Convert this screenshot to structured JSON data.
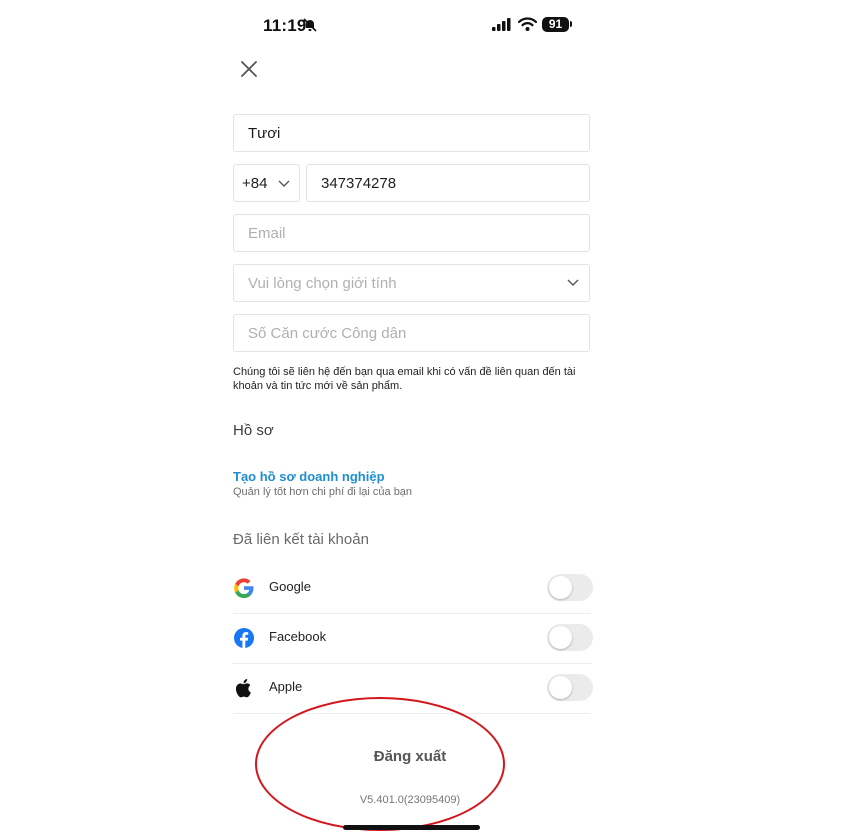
{
  "status_bar": {
    "time": "11:19",
    "battery": "91"
  },
  "form": {
    "name_value": "Tươi",
    "country_code": "+84",
    "phone_value": "347374278",
    "email_placeholder": "Email",
    "gender_placeholder": "Vui lòng chọn giới tính",
    "id_placeholder": "Số Căn cước Công dân",
    "note": "Chúng tôi sẽ liên hệ đến bạn qua email khi có vấn đề liên quan đến tài khoản và tin tức mới về sản phẩm."
  },
  "profile": {
    "heading": "Hồ sơ",
    "business_link": "Tạo hồ sơ doanh nghiệp",
    "business_subtitle": "Quản lý tốt hơn chi phí đi lại của bạn"
  },
  "linked": {
    "heading": "Đã liên kết tài khoản",
    "accounts": [
      {
        "label": "Google",
        "icon": "google-icon",
        "enabled": false
      },
      {
        "label": "Facebook",
        "icon": "facebook-icon",
        "enabled": false
      },
      {
        "label": "Apple",
        "icon": "apple-icon",
        "enabled": false
      }
    ]
  },
  "footer": {
    "logout_label": "Đăng xuất",
    "version": "V5.401.0(23095409)"
  },
  "colors": {
    "link": "#1d8fd1",
    "annotation_circle": "#d3161c",
    "facebook": "#1877f2"
  }
}
